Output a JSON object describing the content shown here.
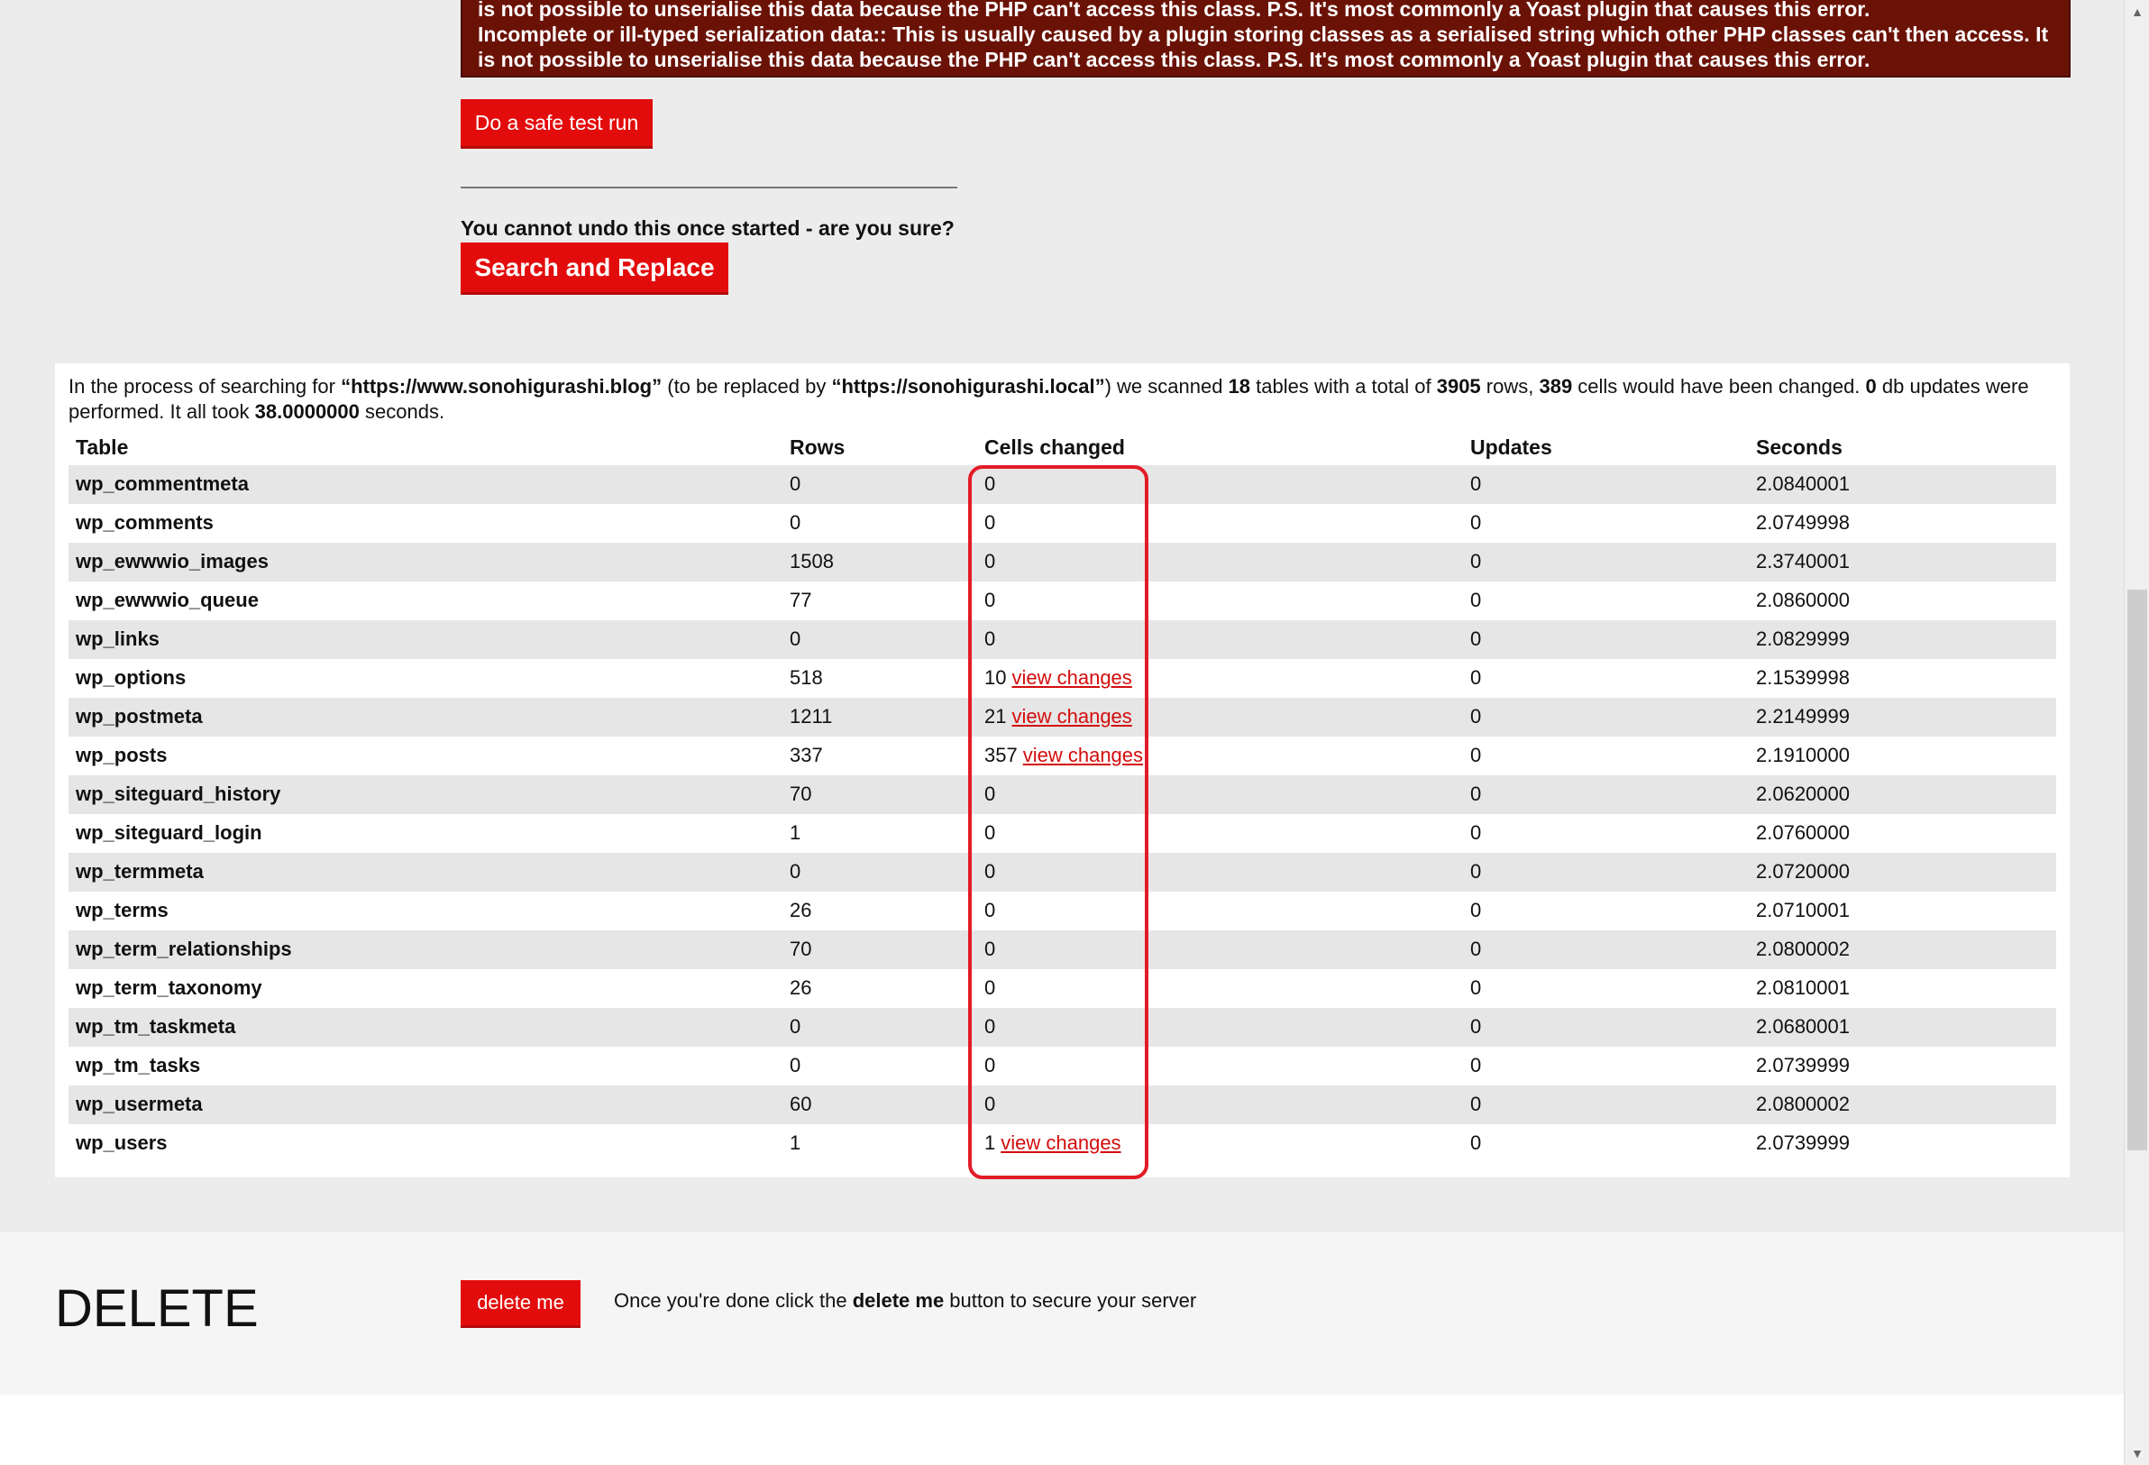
{
  "error": {
    "line1": "is not possible to unserialise this data because the PHP can't access this class. P.S. It's most commonly a Yoast plugin that causes this error.",
    "line2": "Incomplete or ill-typed serialization data:: This is usually caused by a plugin storing classes as a serialised string which other PHP classes can't then access. It",
    "line3": "is not possible to unserialise this data because the PHP can't access this class. P.S. It's most commonly a Yoast plugin that causes this error."
  },
  "buttons": {
    "safe_test": "Do a safe test run",
    "confirm_text": "You cannot undo this once started - are you sure?",
    "search_replace": "Search and Replace",
    "delete": "delete me"
  },
  "summary": {
    "t1": "In the process of searching for ",
    "search": "“https://www.sonohigurashi.blog”",
    "t2": " (to be replaced by ",
    "replace": "“https://sonohigurashi.local”",
    "t3": ") we scanned ",
    "tables": "18",
    "t4": " tables with a total of ",
    "rows": "3905",
    "t5": " rows, ",
    "cells": "389",
    "t6": " cells would have been changed. ",
    "updates": "0",
    "t7": " db updates were performed. It all took ",
    "seconds": "38.0000000",
    "t8": " seconds."
  },
  "table": {
    "headers": {
      "table": "Table",
      "rows": "Rows",
      "cells": "Cells changed",
      "updates": "Updates",
      "seconds": "Seconds"
    },
    "link_label": "view changes",
    "rows": [
      {
        "name": "wp_commentmeta",
        "rows": "0",
        "cells": "0",
        "updates": "0",
        "seconds": "2.0840001"
      },
      {
        "name": "wp_comments",
        "rows": "0",
        "cells": "0",
        "updates": "0",
        "seconds": "2.0749998"
      },
      {
        "name": "wp_ewwwio_images",
        "rows": "1508",
        "cells": "0",
        "updates": "0",
        "seconds": "2.3740001"
      },
      {
        "name": "wp_ewwwio_queue",
        "rows": "77",
        "cells": "0",
        "updates": "0",
        "seconds": "2.0860000"
      },
      {
        "name": "wp_links",
        "rows": "0",
        "cells": "0",
        "updates": "0",
        "seconds": "2.0829999"
      },
      {
        "name": "wp_options",
        "rows": "518",
        "cells": "10",
        "updates": "0",
        "seconds": "2.1539998"
      },
      {
        "name": "wp_postmeta",
        "rows": "1211",
        "cells": "21",
        "updates": "0",
        "seconds": "2.2149999"
      },
      {
        "name": "wp_posts",
        "rows": "337",
        "cells": "357",
        "updates": "0",
        "seconds": "2.1910000"
      },
      {
        "name": "wp_siteguard_history",
        "rows": "70",
        "cells": "0",
        "updates": "0",
        "seconds": "2.0620000"
      },
      {
        "name": "wp_siteguard_login",
        "rows": "1",
        "cells": "0",
        "updates": "0",
        "seconds": "2.0760000"
      },
      {
        "name": "wp_termmeta",
        "rows": "0",
        "cells": "0",
        "updates": "0",
        "seconds": "2.0720000"
      },
      {
        "name": "wp_terms",
        "rows": "26",
        "cells": "0",
        "updates": "0",
        "seconds": "2.0710001"
      },
      {
        "name": "wp_term_relationships",
        "rows": "70",
        "cells": "0",
        "updates": "0",
        "seconds": "2.0800002"
      },
      {
        "name": "wp_term_taxonomy",
        "rows": "26",
        "cells": "0",
        "updates": "0",
        "seconds": "2.0810001"
      },
      {
        "name": "wp_tm_taskmeta",
        "rows": "0",
        "cells": "0",
        "updates": "0",
        "seconds": "2.0680001"
      },
      {
        "name": "wp_tm_tasks",
        "rows": "0",
        "cells": "0",
        "updates": "0",
        "seconds": "2.0739999"
      },
      {
        "name": "wp_usermeta",
        "rows": "60",
        "cells": "0",
        "updates": "0",
        "seconds": "2.0800002"
      },
      {
        "name": "wp_users",
        "rows": "1",
        "cells": "1",
        "updates": "0",
        "seconds": "2.0739999"
      }
    ]
  },
  "delete_section": {
    "title": "DELETE",
    "text_before": "Once you're done click the ",
    "text_bold": "delete me",
    "text_after": " button to secure your server"
  },
  "colors": {
    "accent": "#e30c0c",
    "error_bg": "#6b1206",
    "highlight": "#e31b26"
  }
}
